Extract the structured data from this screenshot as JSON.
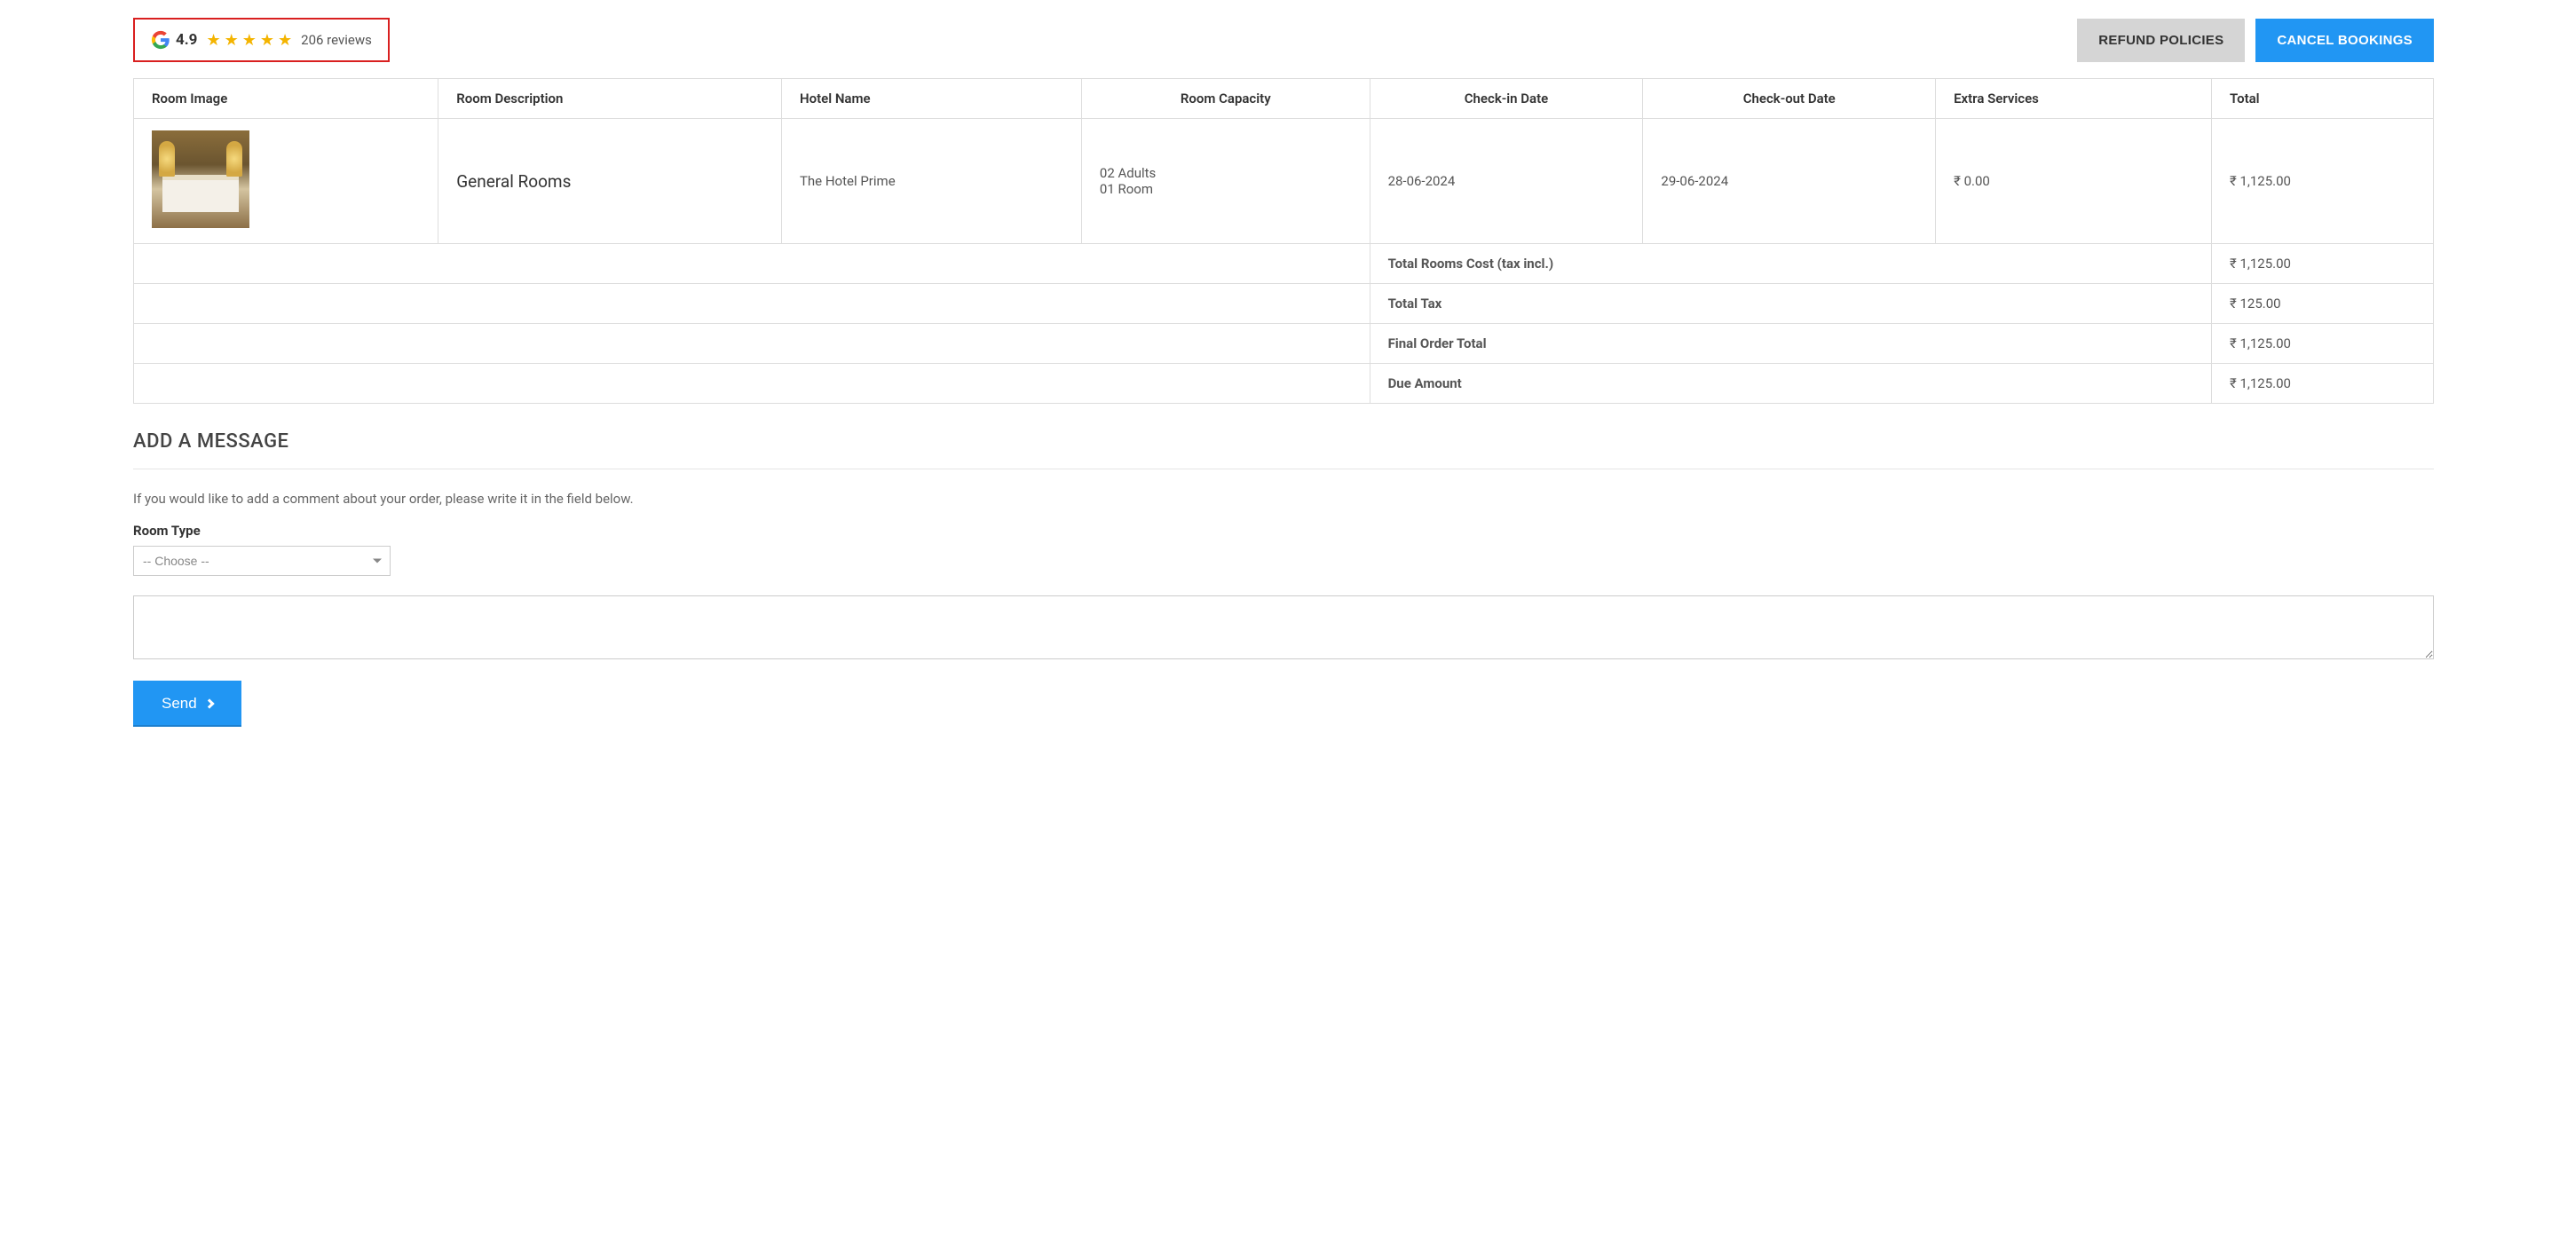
{
  "rating": {
    "value": "4.9",
    "reviews": "206 reviews"
  },
  "buttons": {
    "refund": "REFUND POLICIES",
    "cancel": "CANCEL BOOKINGS",
    "send": "Send"
  },
  "table": {
    "headers": {
      "image": "Room Image",
      "description": "Room Description",
      "hotel": "Hotel Name",
      "capacity": "Room Capacity",
      "checkin": "Check-in Date",
      "checkout": "Check-out Date",
      "extras": "Extra Services",
      "total": "Total"
    },
    "row": {
      "description": "General Rooms",
      "hotel": "The Hotel Prime",
      "capacity_line1": "02 Adults",
      "capacity_line2": "01 Room",
      "checkin": "28-06-2024",
      "checkout": "29-06-2024",
      "extras": "₹ 0.00",
      "total": "₹ 1,125.00"
    },
    "summary": {
      "rooms_cost_label": "Total Rooms Cost (tax incl.)",
      "rooms_cost_value": "₹ 1,125.00",
      "tax_label": "Total Tax",
      "tax_value": "₹ 125.00",
      "final_label": "Final Order Total",
      "final_value": "₹ 1,125.00",
      "due_label": "Due Amount",
      "due_value": "₹ 1,125.00"
    }
  },
  "message_section": {
    "title": "ADD A MESSAGE",
    "hint": "If you would like to add a comment about your order, please write it in the field below.",
    "room_type_label": "Room Type",
    "room_type_placeholder": "-- Choose --"
  }
}
